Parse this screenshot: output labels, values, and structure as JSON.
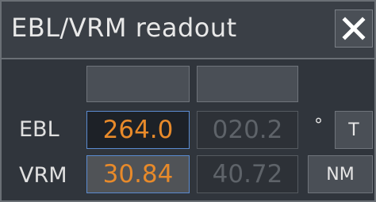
{
  "window": {
    "title": "EBL/VRM readout"
  },
  "rows": {
    "ebl": {
      "label": "EBL",
      "primary": "264.0",
      "secondary": "020.2",
      "unit_symbol": "°",
      "unit_button": "T"
    },
    "vrm": {
      "label": "VRM",
      "primary": "30.84",
      "secondary": "40.72",
      "unit_button": "NM"
    }
  },
  "icons": {
    "close": "close-icon"
  },
  "colors": {
    "active_value": "#e88a2a",
    "inactive_value": "#5e6369",
    "active_border": "#5b8bd0"
  }
}
